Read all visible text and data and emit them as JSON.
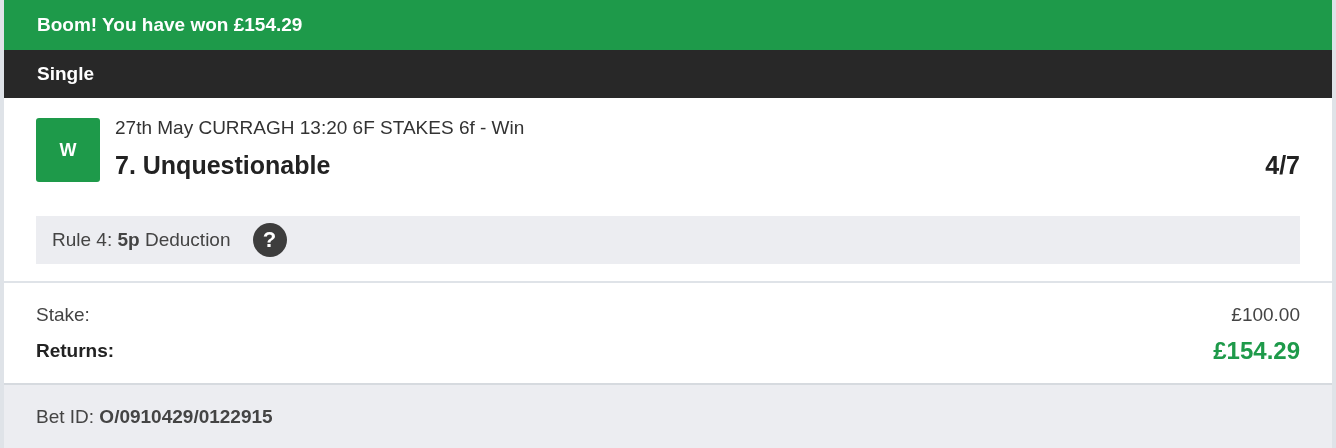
{
  "banner": {
    "text": "Boom! You have won £154.29"
  },
  "bet_type": "Single",
  "selection": {
    "result": "W",
    "event": "27th May CURRAGH 13:20 6F STAKES 6f - Win",
    "name": "7. Unquestionable",
    "odds": "4/7"
  },
  "rule4": {
    "text": "Rule 4: **5p** Deduction",
    "help": "?"
  },
  "summary": [
    {
      "label": "Stake:",
      "value": "£100.00",
      "kind": "plain"
    },
    {
      "label": "Returns:",
      "value": "£154.29",
      "kind": "returns"
    }
  ],
  "bet_id": "Bet ID: **O/0910429/0122915**"
}
